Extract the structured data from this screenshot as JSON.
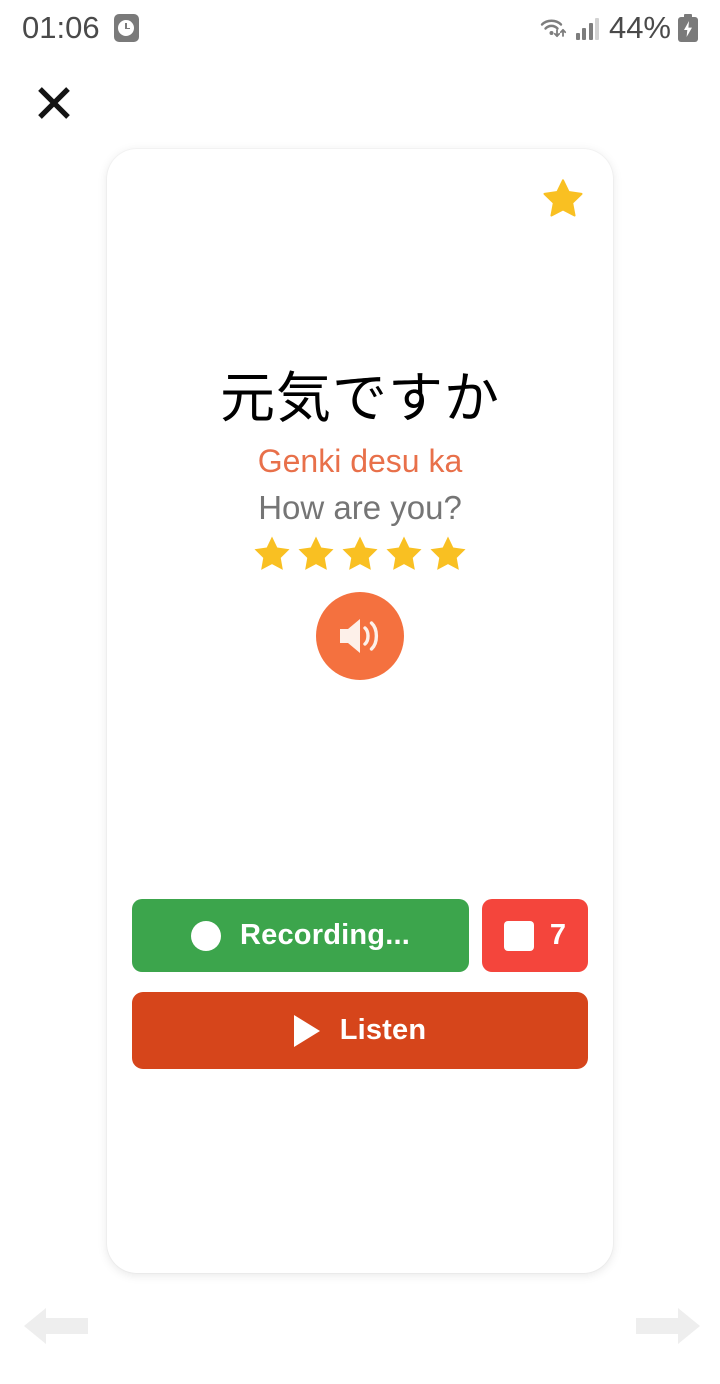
{
  "status_bar": {
    "time": "01:06",
    "alarm_icon": "alarm-clock-icon",
    "wifi_icon": "wifi-transfer-icon",
    "signal_icon": "cellular-signal-icon",
    "battery_percent": "44%",
    "battery_icon": "battery-charging-icon"
  },
  "header": {
    "close_icon": "close-icon"
  },
  "card": {
    "favorite_icon": "star-icon",
    "favorite_active": true,
    "phrase_japanese": "元気ですか",
    "phrase_romaji": "Genki desu ka",
    "phrase_translation": "How are you?",
    "rating": 5,
    "rating_max": 5,
    "star_icon": "star-icon",
    "speaker_icon": "speaker-volume-icon"
  },
  "actions": {
    "record": {
      "label": "Recording...",
      "icon": "record-circle-icon",
      "state": "recording"
    },
    "stop": {
      "icon": "stop-square-icon",
      "countdown": "7"
    },
    "listen": {
      "label": "Listen",
      "icon": "play-triangle-icon"
    }
  },
  "navigation": {
    "prev_icon": "arrow-left-icon",
    "next_icon": "arrow-right-icon"
  },
  "colors": {
    "accent_orange": "#f4713f",
    "romaji_orange": "#e8704a",
    "record_green": "#3ca54c",
    "stop_red": "#f4453c",
    "listen_red": "#d6451b",
    "star_gold": "#f9c022",
    "translation_gray": "#757575",
    "nav_arrow_gray": "#eeeeee"
  }
}
